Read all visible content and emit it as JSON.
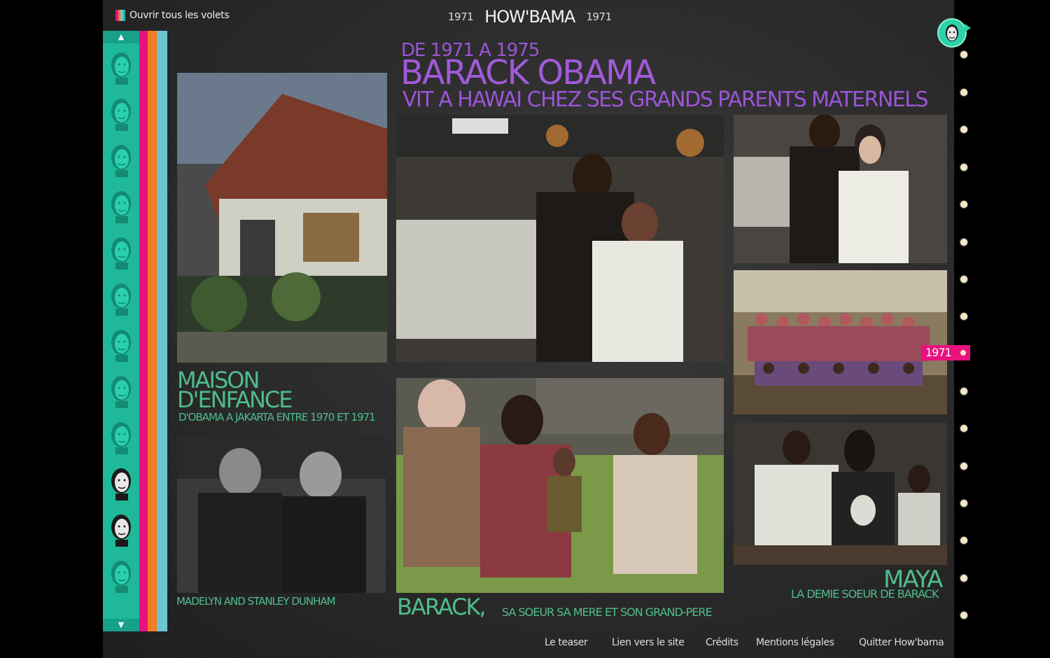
{
  "topbar": {
    "open_all_label": "Ouvrir tous les volets",
    "year_left": "1971",
    "logo": "HOW'BAMA",
    "year_right": "1971"
  },
  "colors": {
    "sidebar_green": "#1fb89a",
    "stripe_pink": "#e8127e",
    "stripe_orange": "#f57c22",
    "stripe_cyan": "#6cc6d2",
    "heading_purple": "#9b55d6",
    "caption_green": "#4fbd8c"
  },
  "sidebar": {
    "up_icon": "▲",
    "down_icon": "▼",
    "faces": [
      "portrait-1",
      "portrait-2",
      "portrait-3",
      "portrait-4",
      "portrait-5",
      "portrait-6",
      "portrait-7",
      "portrait-8",
      "portrait-9",
      "portrait-10",
      "portrait-11",
      "portrait-12"
    ]
  },
  "heading": {
    "period": "DE 1971 A 1975",
    "name": "BARACK OBAMA",
    "subtitle": "VIT A HAWAI CHEZ SES GRANDS PARENTS MATERNELS"
  },
  "captions": {
    "house_title_1": "MAISON",
    "house_title_2": "D'ENFANCE",
    "house_sub": "D'OBAMA A JAKARTA ENTRE 1970 ET 1971",
    "grandparents": "MADELYN AND STANLEY DUNHAM",
    "family_title": "BARACK,",
    "family_sub": "SA SOEUR SA MERE ET SON GRAND-PERE",
    "maya_title": "MAYA",
    "maya_sub": "LA DEMIE SOEUR DE BARACK"
  },
  "timeline": {
    "current_year": "1971"
  },
  "footer": {
    "teaser": "Le teaser",
    "site_link": "Lien vers le site",
    "credits": "Crédits",
    "legal": "Mentions légales",
    "quit": "Quitter How'bama"
  }
}
